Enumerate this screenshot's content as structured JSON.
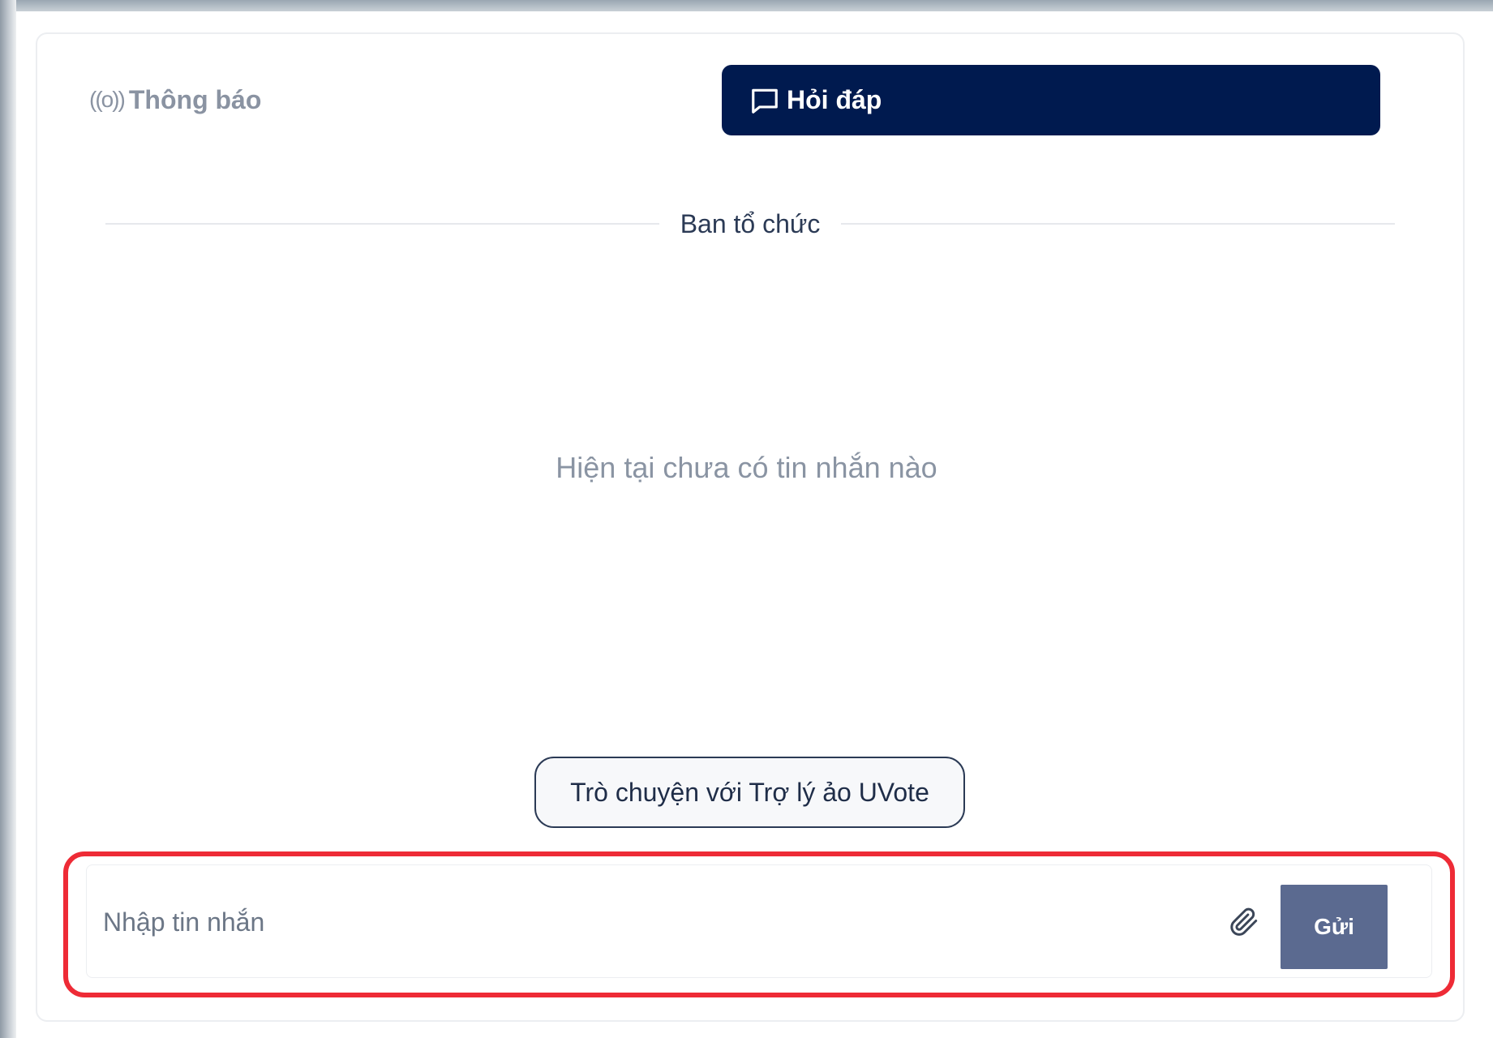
{
  "tabs": {
    "notify": {
      "icon_text": "((o))",
      "label": "Thông báo"
    },
    "qa": {
      "label": "Hỏi đáp",
      "active": true
    }
  },
  "divider": {
    "label": "Ban tổ chức"
  },
  "empty_state": {
    "text": "Hiện tại chưa có tin nhắn nào"
  },
  "assistant_button": {
    "label": "Trò chuyện với Trợ lý ảo UVote"
  },
  "composer": {
    "placeholder": "Nhập tin nhắn",
    "value": "",
    "send_label": "Gửi"
  },
  "icons": {
    "notify_icon": "broadcast-icon",
    "qa_icon": "chat-bubble-icon",
    "attach_icon": "paperclip-icon"
  },
  "colors": {
    "active_tab_bg": "#001a4f",
    "send_button_bg": "#5b6a90",
    "highlight": "#ee2b36"
  }
}
